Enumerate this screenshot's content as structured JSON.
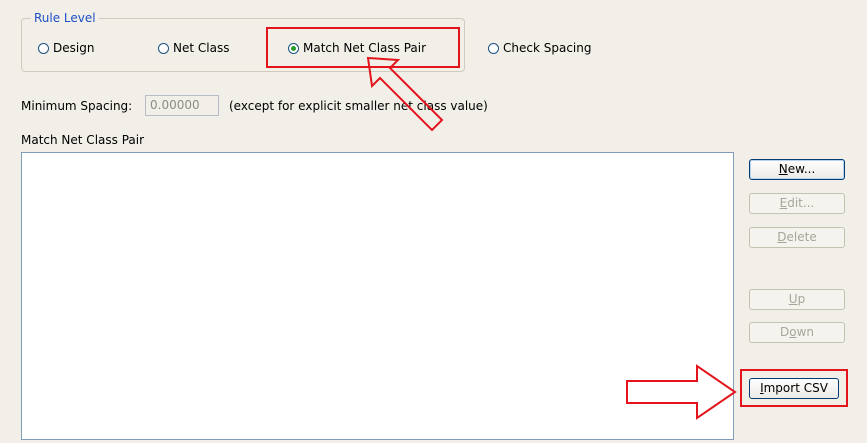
{
  "rule_level": {
    "legend": "Rule Level",
    "options": [
      {
        "label": "Design",
        "selected": false
      },
      {
        "label": "Net Class",
        "selected": false
      },
      {
        "label": "Match Net Class Pair",
        "selected": true
      },
      {
        "label": "Check Spacing",
        "selected": false
      }
    ]
  },
  "spacing": {
    "label": "Minimum Spacing:",
    "value": "0.00000",
    "note": "(except for explicit smaller net class value)"
  },
  "list": {
    "label": "Match Net Class Pair",
    "items": []
  },
  "buttons": {
    "new": {
      "first": "N",
      "rest": "ew..."
    },
    "edit": {
      "first": "E",
      "rest": "dit..."
    },
    "delete": {
      "first": "D",
      "rest": "elete"
    },
    "up": {
      "first": "U",
      "rest": "p"
    },
    "down": {
      "pre": "D",
      "underline": "o",
      "post": "wn"
    },
    "import": {
      "first": "I",
      "rest": "mport CSV"
    }
  },
  "colors": {
    "highlight": "#e3141b",
    "radio_selected": "#2a9a2a",
    "legend": "#1f4fc6"
  }
}
